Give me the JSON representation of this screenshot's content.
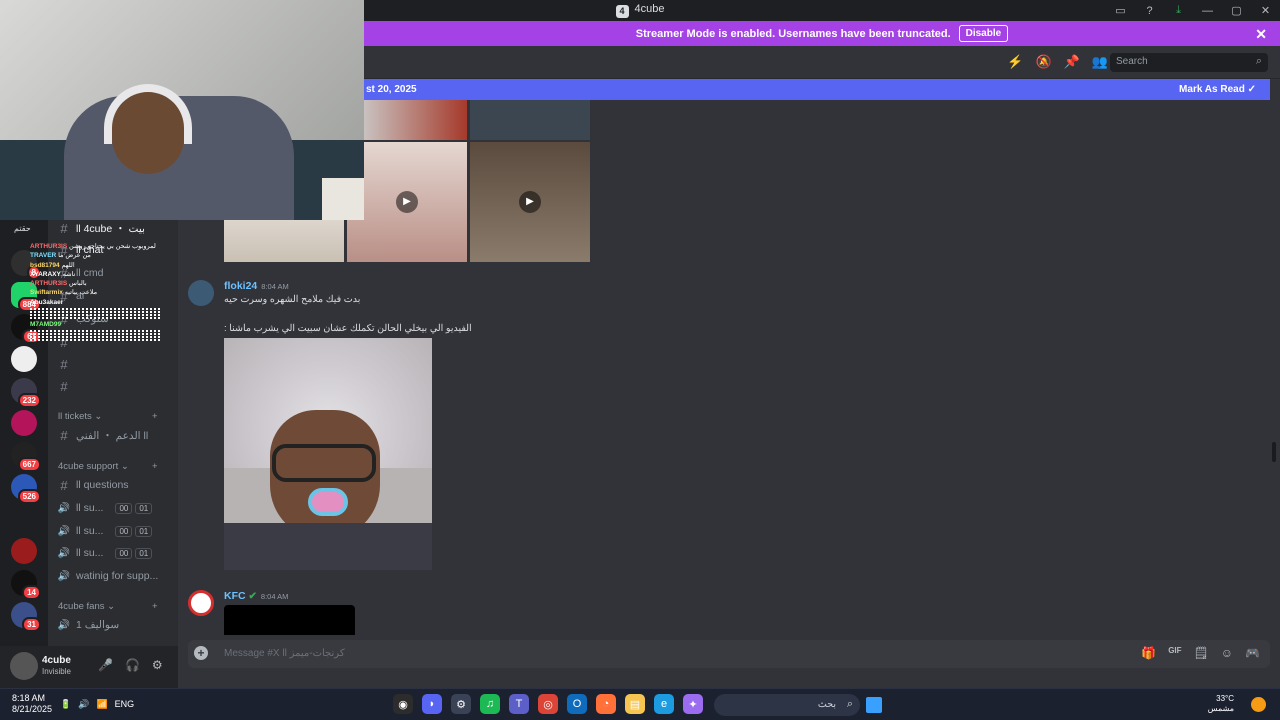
{
  "window": {
    "title": "4cube",
    "logo_text": "4",
    "controls": [
      "▭",
      "?",
      "⤓",
      "—",
      "▢",
      "✕"
    ]
  },
  "banner": {
    "text": "Streamer Mode is enabled. Usernames have been truncated.",
    "disable_label": "Disable",
    "close": "✕"
  },
  "header": {
    "icons": [
      "⚡",
      "🔕",
      "📌",
      "👥"
    ],
    "search_placeholder": "Search",
    "search_icon": "⌕"
  },
  "unread_bar": {
    "date_text": "st 20, 2025",
    "mark_label": "Mark As Read"
  },
  "channels": [
    {
      "label": "ll 4cube ・ بيت",
      "icon": "#"
    },
    {
      "label": "ll chat",
      "icon": "#"
    },
    {
      "label": "ll cmd",
      "icon": "#"
    },
    {
      "label": "ai",
      "icon": "#"
    },
    {
      "label": "ستوكب",
      "icon": "#"
    },
    {
      "label": "",
      "icon": "#"
    },
    {
      "label": "",
      "icon": "#"
    },
    {
      "label": "",
      "icon": "#"
    }
  ],
  "categories": {
    "tickets": "ll tickets",
    "support": "4cube support",
    "fans": "4cube fans"
  },
  "support_channels": [
    {
      "label": "الدعم ・ الفني ll",
      "icon": "#"
    },
    {
      "label": "ll questions",
      "icon": "#"
    },
    {
      "label": "ll su...",
      "icon": "🔊",
      "c1": "00",
      "c2": "01"
    },
    {
      "label": "ll su...",
      "icon": "🔊",
      "c1": "00",
      "c2": "01"
    },
    {
      "label": "ll su...",
      "icon": "🔊",
      "c1": "00",
      "c2": "01"
    },
    {
      "label": "watinig for supp...",
      "icon": "🔊"
    },
    {
      "label": "سواليف 1",
      "icon": "🔊"
    }
  ],
  "guild_badges": [
    "1",
    "8",
    "884",
    "61",
    "232",
    "667",
    "526",
    "14",
    "31"
  ],
  "guild_label_top": "حقتم",
  "user": {
    "name": "4cube",
    "status": "Invisible",
    "icons": [
      "🎤",
      "🎧",
      "⚙"
    ]
  },
  "overlay_lines": [
    {
      "name": "ARTHUR3IS",
      "text": "لمروبوب شحن بي يحتاجو روشن"
    },
    {
      "name": "TRAVER",
      "text": "من عرض ما"
    },
    {
      "name": "bsd81794",
      "text": "اللهم"
    },
    {
      "name": "XYARAXY",
      "text": "ناشه"
    },
    {
      "name": "ARTHUR3IS",
      "text": "بالباس"
    },
    {
      "name": "Swiftarmix",
      "text": "ملاعب بياتيه"
    },
    {
      "name": "Abu3akaer",
      "text": ""
    },
    {
      "name": "M7AMD99",
      "text": ""
    }
  ],
  "messages": [
    {
      "author": "floki24",
      "time": "8:04 AM",
      "line1": "بدت فيك ملامح الشهره وسرت حيه",
      "line2": "الفيديو الي بيخلي الحالن تكملك عشان سبيت الي يشرب ماشنا :"
    },
    {
      "author": "KFC",
      "time": "8:04 AM",
      "verified": "✔"
    }
  ],
  "composer": {
    "placeholder": "Message #X ll كرنجات-ميمز",
    "icons": [
      "🎁",
      "GIF",
      "🗒",
      "☺",
      "🎮"
    ]
  },
  "taskbar": {
    "time": "8:18 AM",
    "date": "8/21/2025",
    "lang": "ENG",
    "search_text": "بحث",
    "weather_temp": "33°C",
    "weather_desc": "مشمس",
    "tray_icons": [
      "🔋",
      "🔊",
      "📶"
    ],
    "app_icons": [
      {
        "name": "obs",
        "glyph": "◉",
        "color": "#2c2c2c"
      },
      {
        "name": "discord",
        "glyph": "◗",
        "color": "#5865f2"
      },
      {
        "name": "settings",
        "glyph": "⚙",
        "color": "#3a4356"
      },
      {
        "name": "spotify",
        "glyph": "♫",
        "color": "#1db954"
      },
      {
        "name": "teams",
        "glyph": "T",
        "color": "#5b5fc7"
      },
      {
        "name": "chrome",
        "glyph": "◎",
        "color": "#db4437"
      },
      {
        "name": "outlook",
        "glyph": "O",
        "color": "#0f6cbd"
      },
      {
        "name": "firefox",
        "glyph": "◔",
        "color": "#ff7139"
      },
      {
        "name": "files",
        "glyph": "▤",
        "color": "#f5c451"
      },
      {
        "name": "edge",
        "glyph": "e",
        "color": "#1c9be0"
      },
      {
        "name": "copilot",
        "glyph": "✦",
        "color": "#9b6cf0"
      }
    ]
  }
}
